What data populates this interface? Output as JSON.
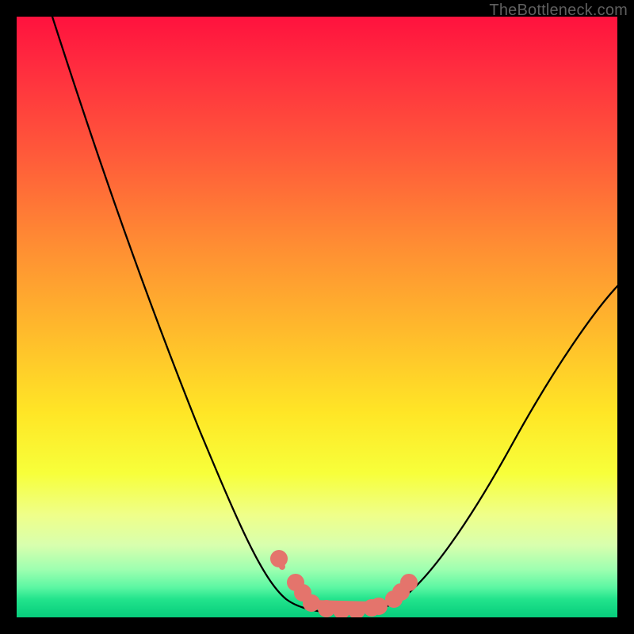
{
  "watermark": "TheBottleneck.com",
  "chart_data": {
    "type": "line",
    "title": "",
    "xlabel": "",
    "ylabel": "",
    "xlim": [
      0,
      100
    ],
    "ylim": [
      0,
      100
    ],
    "grid": false,
    "legend": false,
    "background_gradient": [
      "#ff123e",
      "#ff8d33",
      "#ffe626",
      "#9effb0",
      "#08cd7c"
    ],
    "series": [
      {
        "name": "bottleneck-curve",
        "color": "#000000",
        "x": [
          6,
          10,
          15,
          20,
          25,
          30,
          35,
          40,
          43,
          46,
          49,
          52,
          55,
          58,
          61,
          64,
          67,
          71,
          76,
          82,
          88,
          94,
          100
        ],
        "y": [
          100,
          87,
          73,
          60,
          48,
          37,
          27,
          17,
          11,
          6,
          3,
          1.5,
          1,
          1,
          1.2,
          2,
          4,
          8,
          15,
          24,
          34,
          44,
          54
        ]
      },
      {
        "name": "highlight-dots",
        "color": "#e4746c",
        "type": "scatter",
        "x": [
          43.7,
          46.4,
          47.6,
          49.1,
          51.5,
          54.0,
          56.6,
          59.2,
          60.3,
          62.8,
          64.0,
          65.3
        ],
        "y": [
          9.8,
          5.8,
          4.1,
          2.6,
          1.5,
          1.2,
          1.2,
          1.5,
          1.8,
          3.1,
          4.2,
          5.8
        ]
      }
    ]
  }
}
